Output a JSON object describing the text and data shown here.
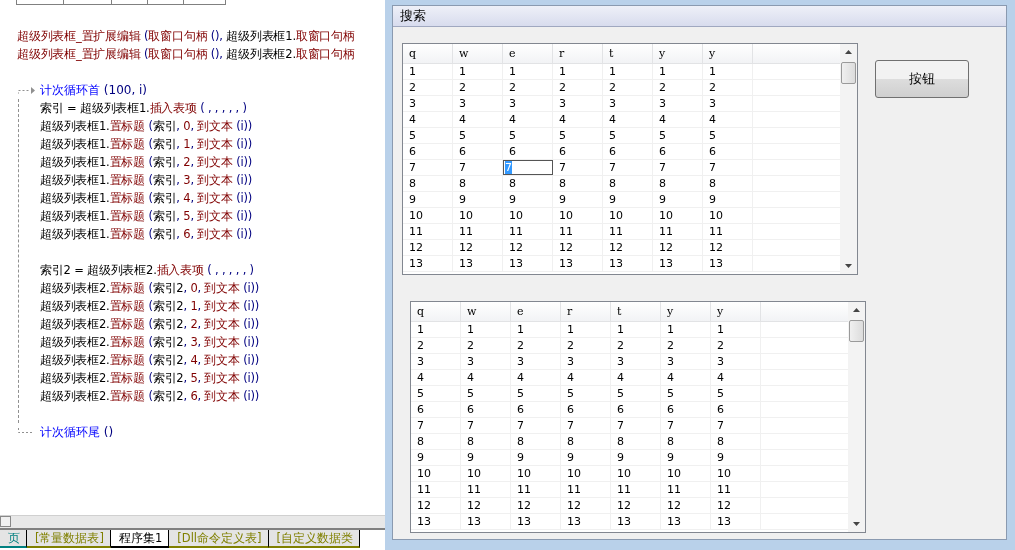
{
  "code": [
    {
      "kind": "line",
      "segs": [
        {
          "t": "超级列表框_置扩展编辑",
          "kind": "func"
        },
        {
          "t": " (",
          "kind": "sym"
        },
        {
          "t": "取窗口句柄",
          "kind": "func"
        },
        {
          "t": " (),",
          "kind": "sym"
        },
        {
          "t": " 超级列表框1.",
          "kind": "name"
        },
        {
          "t": "取窗口句柄",
          "kind": "func"
        }
      ]
    },
    {
      "kind": "line",
      "segs": [
        {
          "t": "超级列表框_置扩展编辑",
          "kind": "func"
        },
        {
          "t": " (",
          "kind": "sym"
        },
        {
          "t": "取窗口句柄",
          "kind": "func"
        },
        {
          "t": " (),",
          "kind": "sym"
        },
        {
          "t": " 超级列表框2.",
          "kind": "name"
        },
        {
          "t": "取窗口句柄",
          "kind": "func"
        }
      ]
    },
    {
      "kind": "blank"
    },
    {
      "kind": "loop",
      "head": [
        {
          "t": "计次循环首",
          "kind": "flow"
        },
        {
          "t": " (100, i)",
          "kind": "sym"
        }
      ],
      "tail": [
        {
          "t": "计次循环尾",
          "kind": "flow"
        },
        {
          "t": " ()",
          "kind": "sym"
        }
      ],
      "children": [
        {
          "kind": "line",
          "segs": [
            {
              "t": "索引 = 超级列表框1.",
              "kind": "name"
            },
            {
              "t": "插入表项",
              "kind": "func"
            },
            {
              "t": " ( , , , , , )",
              "kind": "sym"
            }
          ]
        },
        {
          "kind": "line",
          "segs": [
            {
              "t": "超级列表框1.",
              "kind": "name"
            },
            {
              "t": "置标题",
              "kind": "func"
            },
            {
              "t": " (",
              "kind": "sym"
            },
            {
              "t": "索引",
              "kind": "name"
            },
            {
              "t": ", ",
              "kind": "sym"
            },
            {
              "t": "0",
              "kind": "num"
            },
            {
              "t": ", ",
              "kind": "sym"
            },
            {
              "t": "到文本",
              "kind": "func"
            },
            {
              "t": " (i))",
              "kind": "sym"
            }
          ]
        },
        {
          "kind": "line",
          "segs": [
            {
              "t": "超级列表框1.",
              "kind": "name"
            },
            {
              "t": "置标题",
              "kind": "func"
            },
            {
              "t": " (",
              "kind": "sym"
            },
            {
              "t": "索引",
              "kind": "name"
            },
            {
              "t": ", ",
              "kind": "sym"
            },
            {
              "t": "1",
              "kind": "num"
            },
            {
              "t": ", ",
              "kind": "sym"
            },
            {
              "t": "到文本",
              "kind": "func"
            },
            {
              "t": " (i))",
              "kind": "sym"
            }
          ]
        },
        {
          "kind": "line",
          "segs": [
            {
              "t": "超级列表框1.",
              "kind": "name"
            },
            {
              "t": "置标题",
              "kind": "func"
            },
            {
              "t": " (",
              "kind": "sym"
            },
            {
              "t": "索引",
              "kind": "name"
            },
            {
              "t": ", ",
              "kind": "sym"
            },
            {
              "t": "2",
              "kind": "num"
            },
            {
              "t": ", ",
              "kind": "sym"
            },
            {
              "t": "到文本",
              "kind": "func"
            },
            {
              "t": " (i))",
              "kind": "sym"
            }
          ]
        },
        {
          "kind": "line",
          "segs": [
            {
              "t": "超级列表框1.",
              "kind": "name"
            },
            {
              "t": "置标题",
              "kind": "func"
            },
            {
              "t": " (",
              "kind": "sym"
            },
            {
              "t": "索引",
              "kind": "name"
            },
            {
              "t": ", ",
              "kind": "sym"
            },
            {
              "t": "3",
              "kind": "num"
            },
            {
              "t": ", ",
              "kind": "sym"
            },
            {
              "t": "到文本",
              "kind": "func"
            },
            {
              "t": " (i))",
              "kind": "sym"
            }
          ]
        },
        {
          "kind": "line",
          "segs": [
            {
              "t": "超级列表框1.",
              "kind": "name"
            },
            {
              "t": "置标题",
              "kind": "func"
            },
            {
              "t": " (",
              "kind": "sym"
            },
            {
              "t": "索引",
              "kind": "name"
            },
            {
              "t": ", ",
              "kind": "sym"
            },
            {
              "t": "4",
              "kind": "num"
            },
            {
              "t": ", ",
              "kind": "sym"
            },
            {
              "t": "到文本",
              "kind": "func"
            },
            {
              "t": " (i))",
              "kind": "sym"
            }
          ]
        },
        {
          "kind": "line",
          "segs": [
            {
              "t": "超级列表框1.",
              "kind": "name"
            },
            {
              "t": "置标题",
              "kind": "func"
            },
            {
              "t": " (",
              "kind": "sym"
            },
            {
              "t": "索引",
              "kind": "name"
            },
            {
              "t": ", ",
              "kind": "sym"
            },
            {
              "t": "5",
              "kind": "num"
            },
            {
              "t": ", ",
              "kind": "sym"
            },
            {
              "t": "到文本",
              "kind": "func"
            },
            {
              "t": " (i))",
              "kind": "sym"
            }
          ]
        },
        {
          "kind": "line",
          "segs": [
            {
              "t": "超级列表框1.",
              "kind": "name"
            },
            {
              "t": "置标题",
              "kind": "func"
            },
            {
              "t": " (",
              "kind": "sym"
            },
            {
              "t": "索引",
              "kind": "name"
            },
            {
              "t": ", ",
              "kind": "sym"
            },
            {
              "t": "6",
              "kind": "num"
            },
            {
              "t": ", ",
              "kind": "sym"
            },
            {
              "t": "到文本",
              "kind": "func"
            },
            {
              "t": " (i))",
              "kind": "sym"
            }
          ]
        },
        {
          "kind": "blank"
        },
        {
          "kind": "line",
          "segs": [
            {
              "t": "索引2 = 超级列表框2.",
              "kind": "name"
            },
            {
              "t": "插入表项",
              "kind": "func"
            },
            {
              "t": " ( , , , , , )",
              "kind": "sym"
            }
          ]
        },
        {
          "kind": "line",
          "segs": [
            {
              "t": "超级列表框2.",
              "kind": "name"
            },
            {
              "t": "置标题",
              "kind": "func"
            },
            {
              "t": " (",
              "kind": "sym"
            },
            {
              "t": "索引2",
              "kind": "name"
            },
            {
              "t": ", ",
              "kind": "sym"
            },
            {
              "t": "0",
              "kind": "num"
            },
            {
              "t": ", ",
              "kind": "sym"
            },
            {
              "t": "到文本",
              "kind": "func"
            },
            {
              "t": " (i))",
              "kind": "sym"
            }
          ]
        },
        {
          "kind": "line",
          "segs": [
            {
              "t": "超级列表框2.",
              "kind": "name"
            },
            {
              "t": "置标题",
              "kind": "func"
            },
            {
              "t": " (",
              "kind": "sym"
            },
            {
              "t": "索引2",
              "kind": "name"
            },
            {
              "t": ", ",
              "kind": "sym"
            },
            {
              "t": "1",
              "kind": "num"
            },
            {
              "t": ", ",
              "kind": "sym"
            },
            {
              "t": "到文本",
              "kind": "func"
            },
            {
              "t": " (i))",
              "kind": "sym"
            }
          ]
        },
        {
          "kind": "line",
          "segs": [
            {
              "t": "超级列表框2.",
              "kind": "name"
            },
            {
              "t": "置标题",
              "kind": "func"
            },
            {
              "t": " (",
              "kind": "sym"
            },
            {
              "t": "索引2",
              "kind": "name"
            },
            {
              "t": ", ",
              "kind": "sym"
            },
            {
              "t": "2",
              "kind": "num"
            },
            {
              "t": ", ",
              "kind": "sym"
            },
            {
              "t": "到文本",
              "kind": "func"
            },
            {
              "t": " (i))",
              "kind": "sym"
            }
          ]
        },
        {
          "kind": "line",
          "segs": [
            {
              "t": "超级列表框2.",
              "kind": "name"
            },
            {
              "t": "置标题",
              "kind": "func"
            },
            {
              "t": " (",
              "kind": "sym"
            },
            {
              "t": "索引2",
              "kind": "name"
            },
            {
              "t": ", ",
              "kind": "sym"
            },
            {
              "t": "3",
              "kind": "num"
            },
            {
              "t": ", ",
              "kind": "sym"
            },
            {
              "t": "到文本",
              "kind": "func"
            },
            {
              "t": " (i))",
              "kind": "sym"
            }
          ]
        },
        {
          "kind": "line",
          "segs": [
            {
              "t": "超级列表框2.",
              "kind": "name"
            },
            {
              "t": "置标题",
              "kind": "func"
            },
            {
              "t": " (",
              "kind": "sym"
            },
            {
              "t": "索引2",
              "kind": "name"
            },
            {
              "t": ", ",
              "kind": "sym"
            },
            {
              "t": "4",
              "kind": "num"
            },
            {
              "t": ", ",
              "kind": "sym"
            },
            {
              "t": "到文本",
              "kind": "func"
            },
            {
              "t": " (i))",
              "kind": "sym"
            }
          ]
        },
        {
          "kind": "line",
          "segs": [
            {
              "t": "超级列表框2.",
              "kind": "name"
            },
            {
              "t": "置标题",
              "kind": "func"
            },
            {
              "t": " (",
              "kind": "sym"
            },
            {
              "t": "索引2",
              "kind": "name"
            },
            {
              "t": ", ",
              "kind": "sym"
            },
            {
              "t": "5",
              "kind": "num"
            },
            {
              "t": ", ",
              "kind": "sym"
            },
            {
              "t": "到文本",
              "kind": "func"
            },
            {
              "t": " (i))",
              "kind": "sym"
            }
          ]
        },
        {
          "kind": "line",
          "segs": [
            {
              "t": "超级列表框2.",
              "kind": "name"
            },
            {
              "t": "置标题",
              "kind": "func"
            },
            {
              "t": " (",
              "kind": "sym"
            },
            {
              "t": "索引2",
              "kind": "name"
            },
            {
              "t": ", ",
              "kind": "sym"
            },
            {
              "t": "6",
              "kind": "num"
            },
            {
              "t": ", ",
              "kind": "sym"
            },
            {
              "t": "到文本",
              "kind": "func"
            },
            {
              "t": " (i))",
              "kind": "sym"
            }
          ]
        },
        {
          "kind": "blank"
        }
      ]
    }
  ],
  "tabs": [
    {
      "label": "页",
      "selected": false,
      "color": "#008080"
    },
    {
      "label": "[常量数据表]",
      "selected": false,
      "color": "#808000"
    },
    {
      "label": "程序集1",
      "selected": true,
      "color": "#000000"
    },
    {
      "label": "[Dll命令定义表]",
      "selected": false,
      "color": "#808000"
    },
    {
      "label": "[自定义数据类",
      "selected": false,
      "color": "#808000"
    }
  ],
  "window": {
    "group_title": "搜索",
    "button": "按钮",
    "lists": [
      {
        "columns": [
          "q",
          "w",
          "e",
          "r",
          "t",
          "y",
          "y"
        ],
        "rows": [
          {
            "cells": [
              "1",
              "1",
              "1",
              "1",
              "1",
              "1",
              "1"
            ]
          },
          {
            "cells": [
              "2",
              "2",
              "2",
              "2",
              "2",
              "2",
              "2"
            ]
          },
          {
            "cells": [
              "3",
              "3",
              "3",
              "3",
              "3",
              "3",
              "3"
            ]
          },
          {
            "cells": [
              "4",
              "4",
              "4",
              "4",
              "4",
              "4",
              "4"
            ]
          },
          {
            "cells": [
              "5",
              "5",
              "5",
              "5",
              "5",
              "5",
              "5"
            ]
          },
          {
            "cells": [
              "6",
              "6",
              "6",
              "6",
              "6",
              "6",
              "6"
            ]
          },
          {
            "cells": [
              "7",
              "7",
              {
                "text": "7",
                "editing": true
              },
              "7",
              "7",
              "7",
              "7"
            ]
          },
          {
            "cells": [
              "8",
              "8",
              "8",
              "8",
              "8",
              "8",
              "8"
            ]
          },
          {
            "cells": [
              "9",
              "9",
              "9",
              "9",
              "9",
              "9",
              "9"
            ]
          },
          {
            "cells": [
              "10",
              "10",
              "10",
              "10",
              "10",
              "10",
              "10"
            ]
          },
          {
            "cells": [
              "11",
              "11",
              "11",
              "11",
              "11",
              "11",
              "11"
            ]
          },
          {
            "cells": [
              "12",
              "12",
              "12",
              "12",
              "12",
              "12",
              "12"
            ]
          },
          {
            "cells": [
              "13",
              "13",
              "13",
              "13",
              "13",
              "13",
              "13"
            ]
          }
        ]
      },
      {
        "columns": [
          "q",
          "w",
          "e",
          "r",
          "t",
          "y",
          "y"
        ],
        "rows": [
          {
            "cells": [
              "1",
              "1",
              "1",
              "1",
              "1",
              "1",
              "1"
            ]
          },
          {
            "cells": [
              "2",
              "2",
              "2",
              "2",
              "2",
              "2",
              "2"
            ]
          },
          {
            "cells": [
              "3",
              "3",
              "3",
              "3",
              "3",
              "3",
              "3"
            ]
          },
          {
            "cells": [
              "4",
              "4",
              "4",
              "4",
              "4",
              "4",
              "4"
            ]
          },
          {
            "cells": [
              "5",
              "5",
              "5",
              "5",
              "5",
              "5",
              "5"
            ]
          },
          {
            "cells": [
              "6",
              "6",
              "6",
              "6",
              "6",
              "6",
              "6"
            ]
          },
          {
            "cells": [
              "7",
              "7",
              "7",
              "7",
              "7",
              "7",
              "7"
            ]
          },
          {
            "cells": [
              "8",
              "8",
              "8",
              "8",
              "8",
              "8",
              "8"
            ]
          },
          {
            "cells": [
              "9",
              "9",
              "9",
              "9",
              "9",
              "9",
              "9"
            ]
          },
          {
            "cells": [
              "10",
              "10",
              "10",
              "10",
              "10",
              "10",
              "10"
            ]
          },
          {
            "cells": [
              "11",
              "11",
              "11",
              "11",
              "11",
              "11",
              "11"
            ]
          },
          {
            "cells": [
              "12",
              "12",
              "12",
              "12",
              "12",
              "12",
              "12"
            ]
          },
          {
            "cells": [
              "13",
              "13",
              "13",
              "13",
              "13",
              "13",
              "13"
            ]
          }
        ]
      }
    ]
  }
}
